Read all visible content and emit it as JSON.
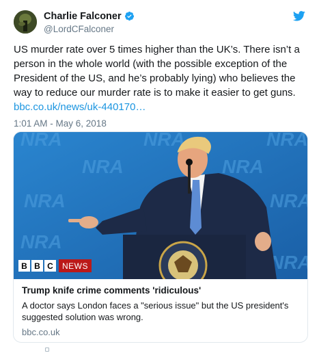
{
  "tweet": {
    "display_name": "Charlie Falconer",
    "handle": "@LordCFalconer",
    "text": "US murder rate over 5 times higher than the UK’s. There isn’t a person in the whole world (with the possible exception of the President of the US, and he’s probably lying) who believes the way to reduce our murder rate is to make it easier to get guns.",
    "link": "bbc.co.uk/news/uk-440170…",
    "timestamp": "1:01 AM - May 6, 2018"
  },
  "card": {
    "title": "Trump knife crime comments 'ridiculous'",
    "description": "A doctor says London faces a \"serious issue\" but the US president's suggested solution was wrong.",
    "domain": "bbc.co.uk",
    "image_logo": {
      "letters": [
        "B",
        "B",
        "C"
      ],
      "news_label": "NEWS"
    },
    "backdrop_text": "NRA"
  },
  "icons": {
    "verified": "verified-badge-icon",
    "twitter": "twitter-bird-icon"
  },
  "colors": {
    "link": "#1b95e0",
    "muted": "#657786",
    "bbc_red": "#bb1919",
    "backdrop_blue": "#1e6fb8"
  }
}
